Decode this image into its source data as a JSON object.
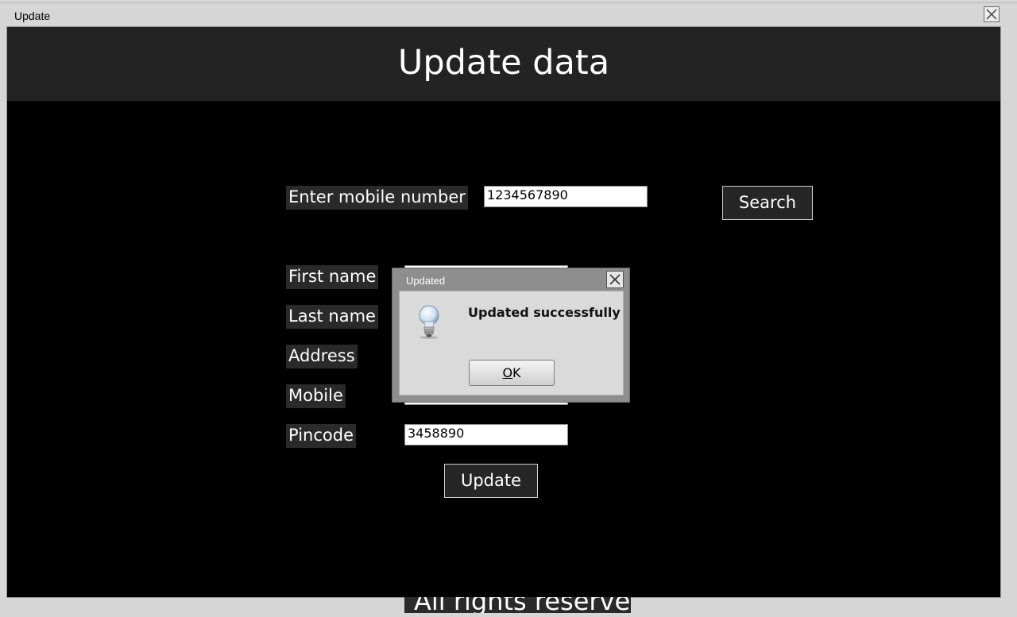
{
  "window": {
    "title": "Update"
  },
  "header": {
    "title": "Update data"
  },
  "search": {
    "label": "Enter mobile number",
    "value": "1234567890",
    "button_label": "Search"
  },
  "form": {
    "first_name_label": "First name",
    "last_name_label": "Last name",
    "address_label": "Address",
    "mobile_label": "Mobile",
    "pincode_label": "Pincode",
    "pincode_value": "3458890",
    "update_button_label": "Update"
  },
  "footer": {
    "text": "All rights reserved"
  },
  "dialog": {
    "title": "Updated",
    "message": "Updated successfully",
    "ok_mnemonic": "O",
    "ok_rest": "K",
    "icon": "lightbulb-icon"
  }
}
